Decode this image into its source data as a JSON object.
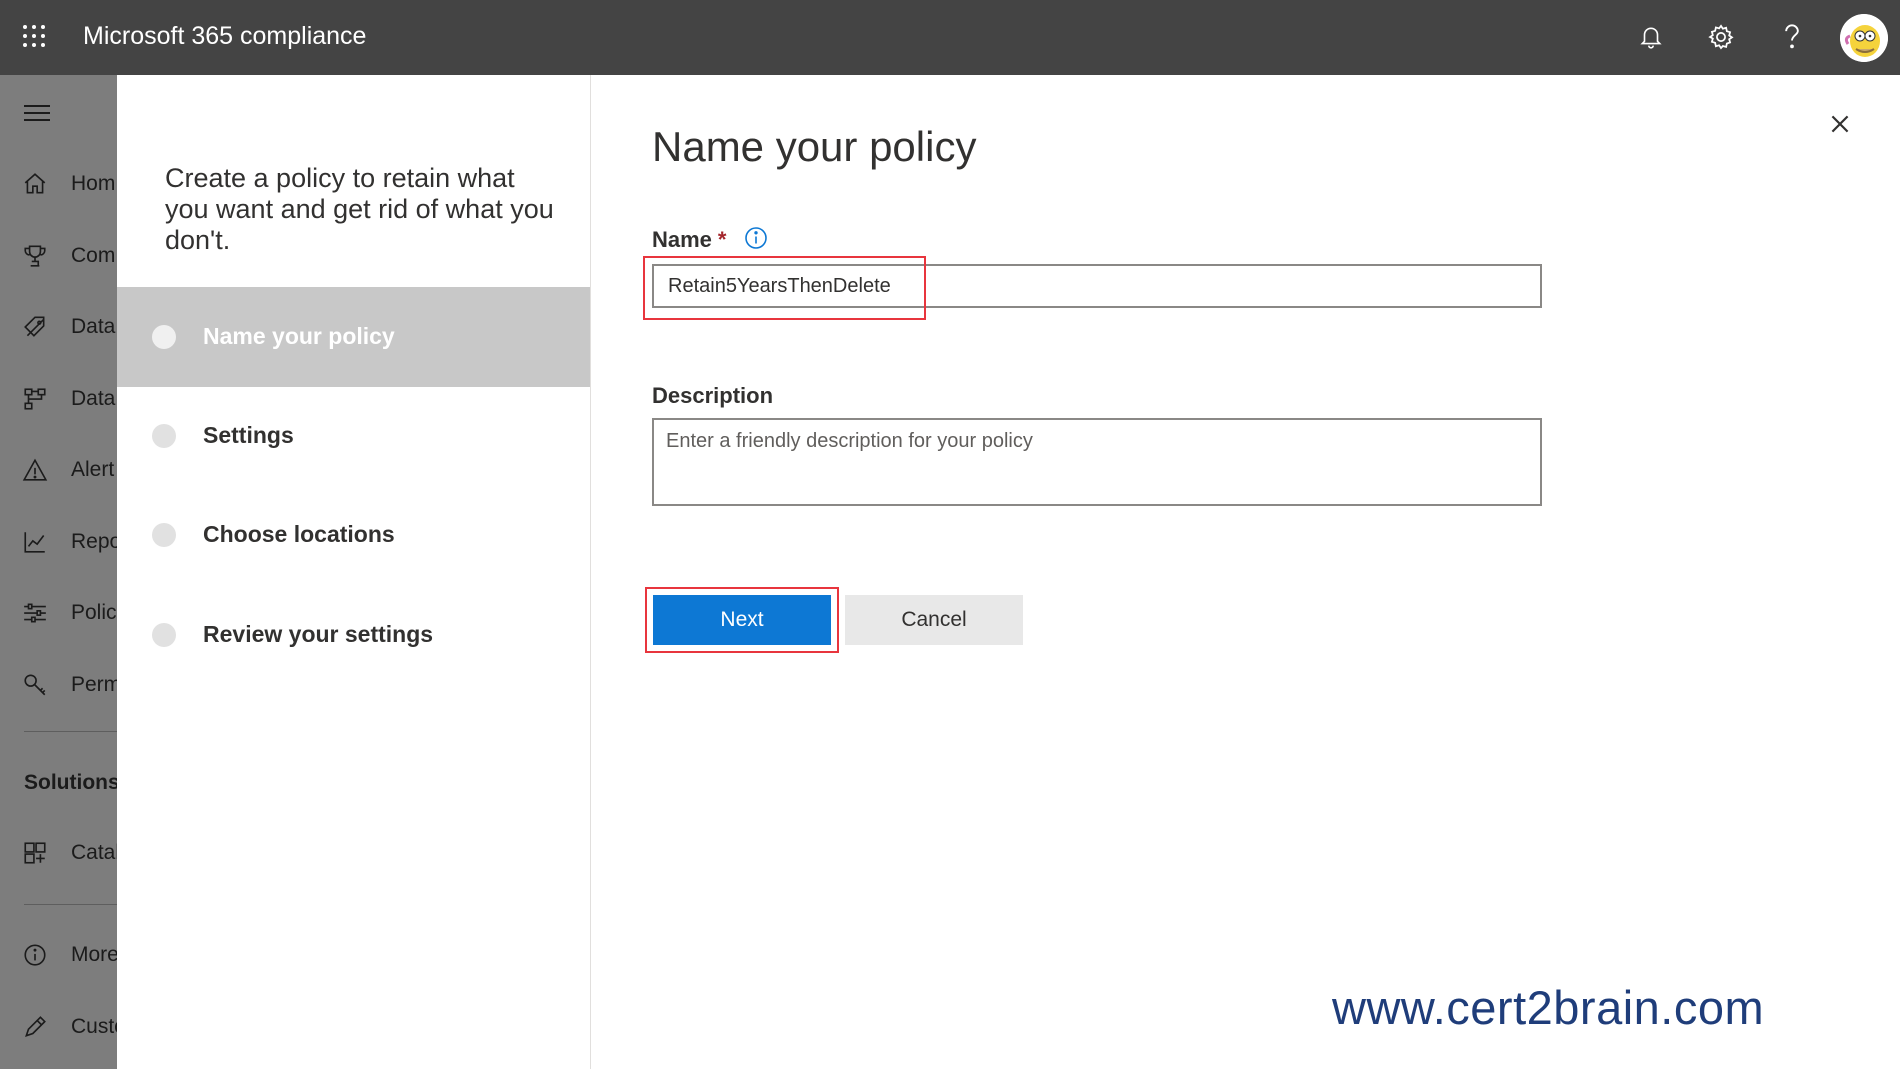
{
  "header": {
    "app_title": "Microsoft 365 compliance",
    "icons": [
      "waffle-icon",
      "bell-icon",
      "gear-icon",
      "help-icon",
      "avatar"
    ]
  },
  "leftnav": {
    "items": [
      {
        "label": "Hom",
        "icon": "home-icon"
      },
      {
        "label": "Com",
        "icon": "trophy-icon"
      },
      {
        "label": "Data",
        "icon": "tag-icon"
      },
      {
        "label": "Data",
        "icon": "flow-icon"
      },
      {
        "label": "Alert",
        "icon": "warning-icon"
      },
      {
        "label": "Repo",
        "icon": "chart-icon"
      },
      {
        "label": "Polic",
        "icon": "sliders-icon"
      },
      {
        "label": "Perm",
        "icon": "key-icon"
      }
    ],
    "solutions_label": "Solutions",
    "solution_items": [
      {
        "label": "Catal",
        "icon": "grid-icon"
      }
    ],
    "bottom_items": [
      {
        "label": "More",
        "icon": "info-icon"
      },
      {
        "label": "Custo",
        "icon": "pencil-icon"
      }
    ]
  },
  "wizard": {
    "intro": "Create a policy to retain what you want and get rid of what you don't.",
    "steps": [
      {
        "label": "Name your policy",
        "active": true
      },
      {
        "label": "Settings",
        "active": false
      },
      {
        "label": "Choose locations",
        "active": false
      },
      {
        "label": "Review your settings",
        "active": false
      }
    ],
    "title": "Name your policy",
    "name_label": "Name",
    "required_mark": "*",
    "name_value": "Retain5YearsThenDelete",
    "description_label": "Description",
    "description_placeholder": "Enter a friendly description for your policy",
    "next_label": "Next",
    "cancel_label": "Cancel"
  },
  "watermark": "www.cert2brain.com",
  "colors": {
    "topbar": "#444444",
    "primary": "#0d78d4",
    "highlight": "#e8353d",
    "active_step": "#c8c8c8"
  }
}
